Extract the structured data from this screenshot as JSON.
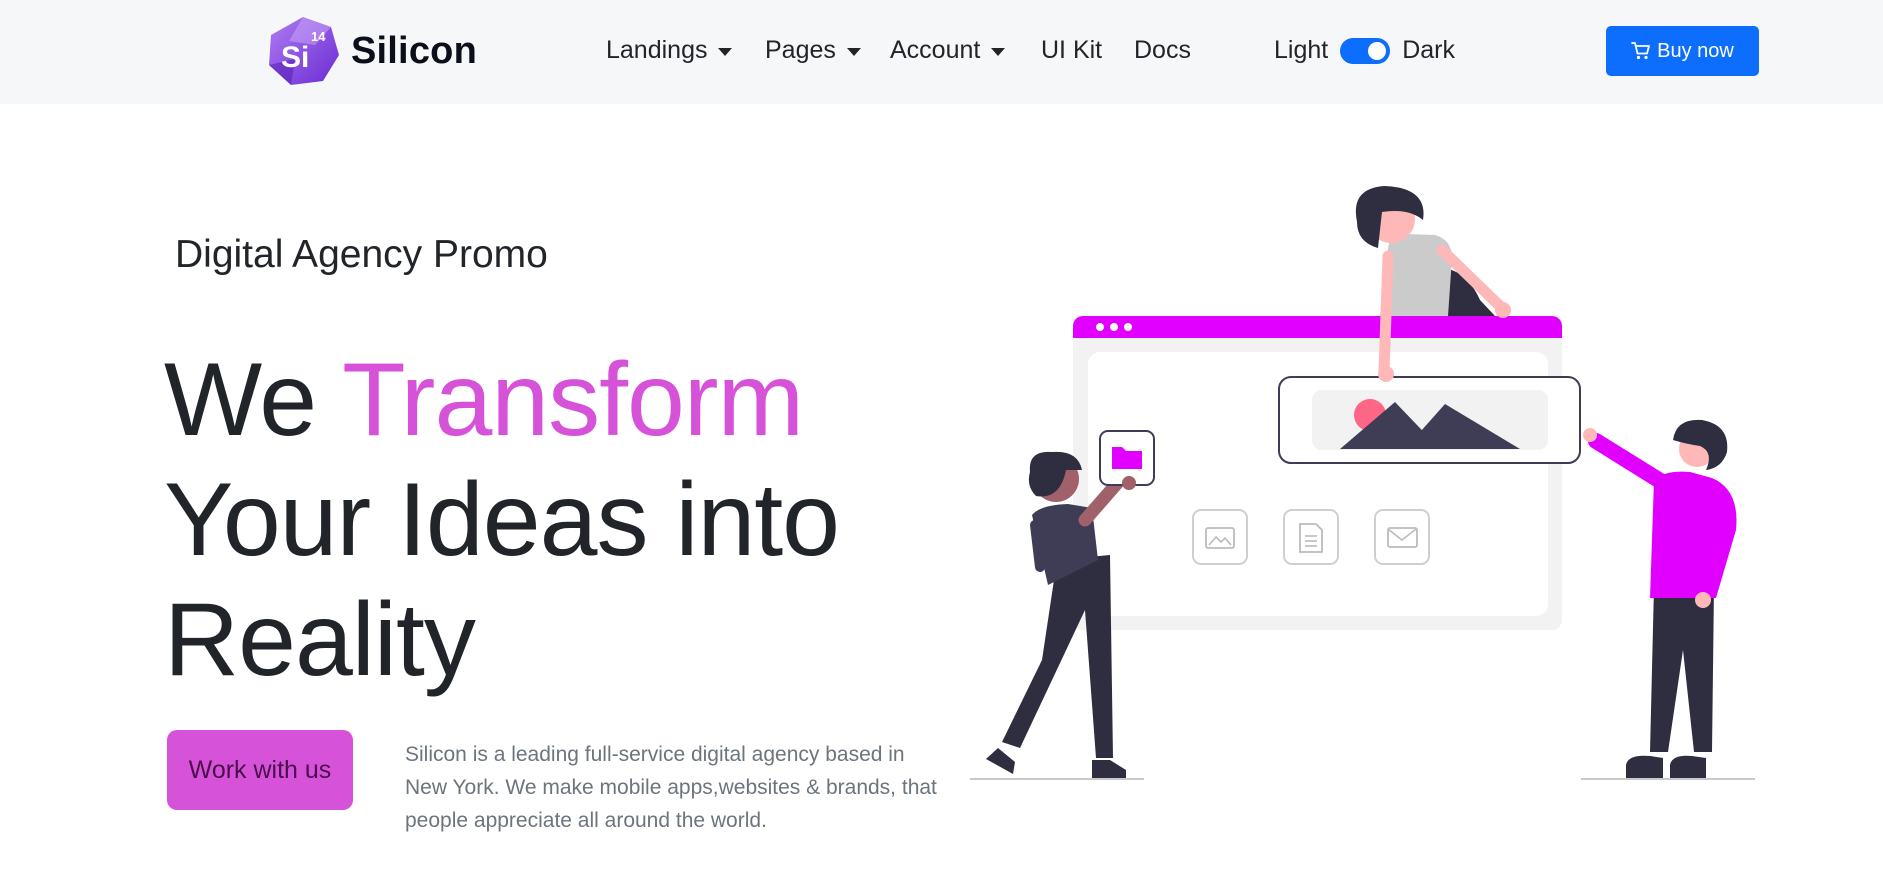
{
  "header": {
    "brand": {
      "name": "Silicon",
      "logo_text": "Si",
      "logo_badge": "14",
      "logo_icon": "silicon-logo-icon"
    },
    "nav": [
      {
        "label": "Landings",
        "dropdown": true
      },
      {
        "label": "Pages",
        "dropdown": true
      },
      {
        "label": "Account",
        "dropdown": true
      },
      {
        "label": "UI Kit",
        "dropdown": false
      },
      {
        "label": "Docs",
        "dropdown": false
      }
    ],
    "theme_switch": {
      "light_label": "Light",
      "dark_label": "Dark",
      "checked": true
    },
    "buy_button": {
      "label": "Buy now",
      "icon": "cart-icon"
    }
  },
  "hero": {
    "eyebrow": "Digital Agency Promo",
    "headline": {
      "word1": "We",
      "accent": "Transform",
      "line2": "Your Ideas into",
      "line3": "Reality"
    },
    "cta_label": "Work with us",
    "description": "Silicon is a leading full-service digital agency based in New York. We make mobile apps,websites & brands, that people appreciate all around the world."
  },
  "colors": {
    "primary": "#0d6efd",
    "accent": "#d652d9",
    "illustration_magenta": "#e100ff",
    "text_dark": "#212529",
    "text_muted": "#6c757d",
    "navbar_bg": "#f6f7f9"
  },
  "illustration": {
    "name": "team-building-website-illustration",
    "icons": [
      "folder-icon",
      "image-icon",
      "document-icon",
      "mail-icon"
    ]
  }
}
